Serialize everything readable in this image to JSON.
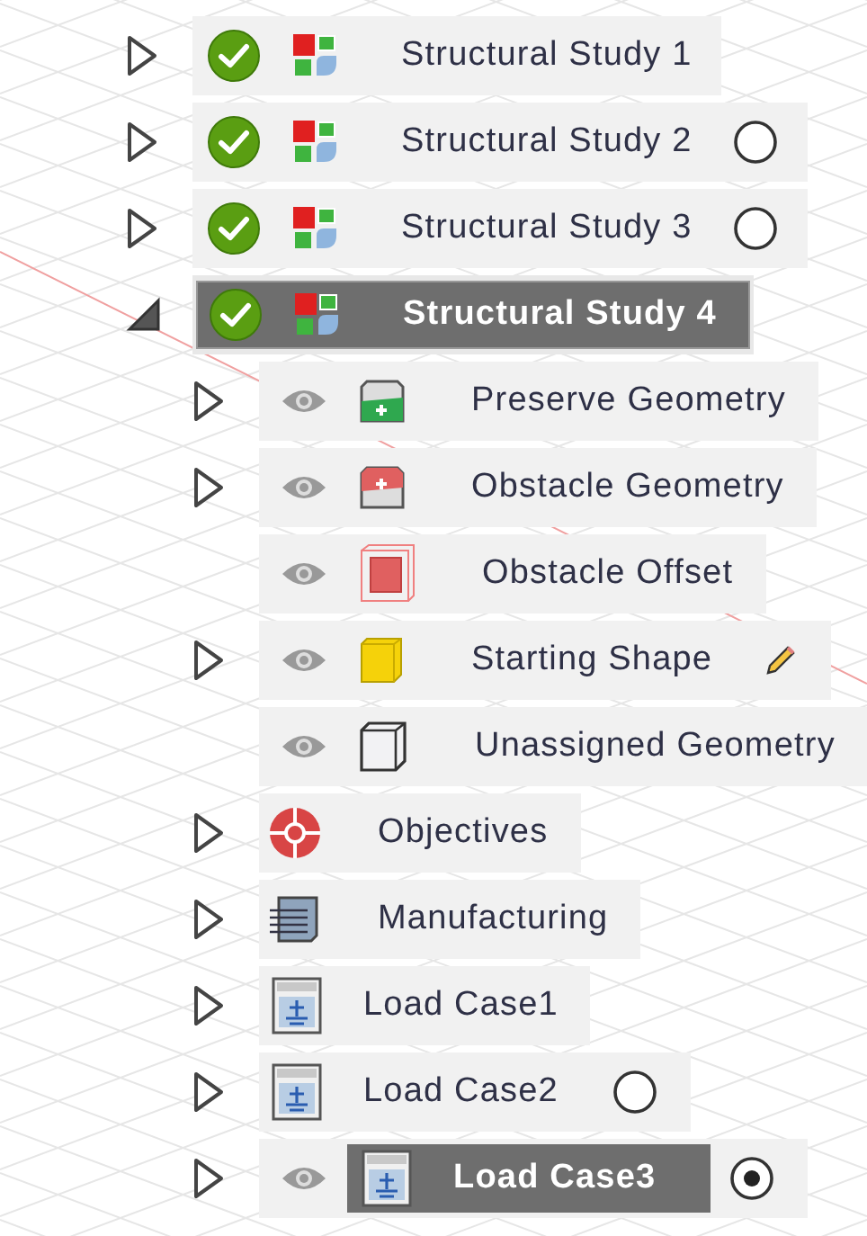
{
  "studies": [
    {
      "label": "Structural Study 1",
      "expanded": false,
      "selected": false,
      "complete": true
    },
    {
      "label": "Structural Study 2",
      "expanded": false,
      "selected": false,
      "complete": true,
      "active": false
    },
    {
      "label": "Structural Study 3",
      "expanded": false,
      "selected": false,
      "complete": true,
      "active": false
    },
    {
      "label": "Structural Study 4",
      "expanded": true,
      "selected": true,
      "complete": true,
      "children": [
        {
          "kind": "preserve",
          "label": "Preserve Geometry",
          "expanded": false,
          "visible": true
        },
        {
          "kind": "obstacle",
          "label": "Obstacle Geometry",
          "expanded": false,
          "visible": true
        },
        {
          "kind": "offset",
          "label": "Obstacle Offset",
          "visible": true
        },
        {
          "kind": "starting",
          "label": "Starting Shape",
          "expanded": false,
          "visible": true,
          "editable": true
        },
        {
          "kind": "unassigned",
          "label": "Unassigned Geometry",
          "visible": true
        },
        {
          "kind": "objectives",
          "label": "Objectives",
          "expanded": false
        },
        {
          "kind": "manufacturing",
          "label": "Manufacturing",
          "expanded": false
        },
        {
          "kind": "loadcase",
          "label": "Load Case1",
          "expanded": false,
          "selected": false
        },
        {
          "kind": "loadcase",
          "label": "Load Case2",
          "expanded": false,
          "selected": false,
          "active": false
        },
        {
          "kind": "loadcase",
          "label": "Load Case3",
          "expanded": false,
          "selected": true,
          "visible": true,
          "active": true
        }
      ]
    }
  ]
}
